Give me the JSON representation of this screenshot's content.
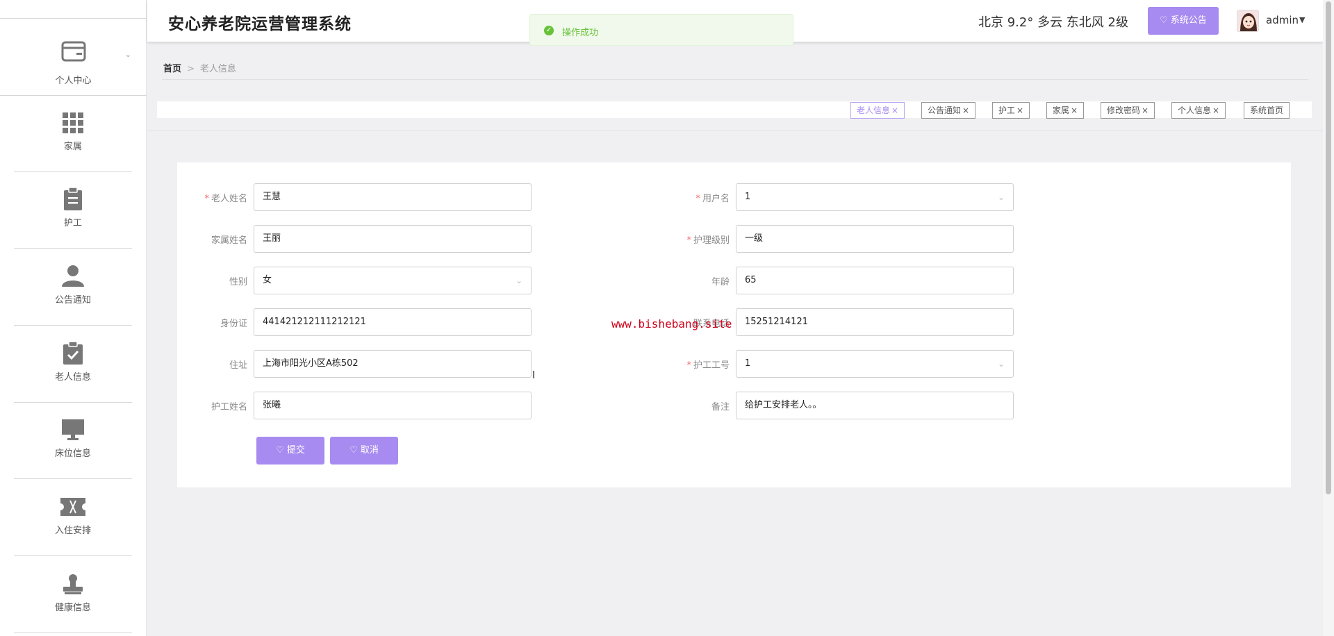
{
  "app": {
    "title": "安心养老院运营管理系统"
  },
  "header": {
    "weather": "北京  9.2°  多云  东北风  2级",
    "notice_button": "系统公告",
    "user": "admin"
  },
  "toast": {
    "text": "操作成功"
  },
  "sidebar": {
    "items": [
      {
        "label": "个人中心",
        "icon": "wallet-icon"
      },
      {
        "label": "家属",
        "icon": "grid-icon"
      },
      {
        "label": "护工",
        "icon": "clipboard-icon"
      },
      {
        "label": "公告通知",
        "icon": "user-icon"
      },
      {
        "label": "老人信息",
        "icon": "clipboard-check-icon"
      },
      {
        "label": "床位信息",
        "icon": "monitor-icon"
      },
      {
        "label": "入住安排",
        "icon": "ticket-icon"
      },
      {
        "label": "健康信息",
        "icon": "stamp-icon"
      }
    ]
  },
  "breadcrumb": {
    "home": "首页",
    "separator": ">",
    "current": "老人信息"
  },
  "tags": [
    {
      "label": "老人信息",
      "active": true
    },
    {
      "label": "公告通知",
      "active": false
    },
    {
      "label": "护工",
      "active": false
    },
    {
      "label": "家属",
      "active": false
    },
    {
      "label": "修改密码",
      "active": false
    },
    {
      "label": "个人信息",
      "active": false
    },
    {
      "label": "系统首页",
      "active": false
    }
  ],
  "form": {
    "elder_name": {
      "label": "老人姓名",
      "value": "王慧",
      "required": true
    },
    "username": {
      "label": "用户名",
      "value": "1",
      "required": true
    },
    "family_name": {
      "label": "家属姓名",
      "value": "王丽"
    },
    "care_level": {
      "label": "护理级别",
      "value": "一级",
      "required": true
    },
    "gender": {
      "label": "性别",
      "value": "女"
    },
    "age": {
      "label": "年龄",
      "value": "65"
    },
    "id_card": {
      "label": "身份证",
      "value": "441421212111212121"
    },
    "phone": {
      "label": "联系电话",
      "value": "15251214121"
    },
    "address": {
      "label": "住址",
      "value": "上海市阳光小区A栋502"
    },
    "caregiver_id": {
      "label": "护工工号",
      "value": "1",
      "required": true
    },
    "caregiver_name": {
      "label": "护工姓名",
      "value": "张曦"
    },
    "remark": {
      "label": "备注",
      "value": "给护工安排老人。。"
    },
    "submit": "提交",
    "cancel": "取消"
  },
  "watermark": "www.bishebang.site",
  "colors": {
    "accent": "#a78bf0",
    "success": "#67c23a",
    "required": "#f56c6c"
  }
}
